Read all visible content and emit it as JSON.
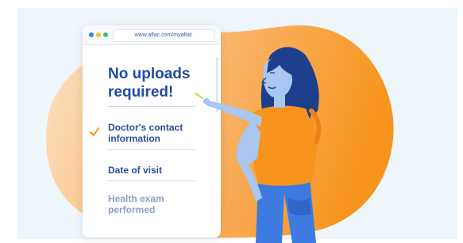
{
  "browser": {
    "url": "www.aflac.com/myaflac"
  },
  "card": {
    "headline": "No uploads required!",
    "items": [
      {
        "label": "Doctor's contact information",
        "checked": true
      },
      {
        "label": "Date of visit",
        "checked": false
      },
      {
        "label": "Health exam performed",
        "checked": false
      }
    ]
  },
  "colors": {
    "headline": "#1f4aa8",
    "accent_orange": "#f7941d",
    "backdrop": "#eef6fb"
  },
  "icons": [
    "check-icon",
    "window-dot-icon"
  ]
}
